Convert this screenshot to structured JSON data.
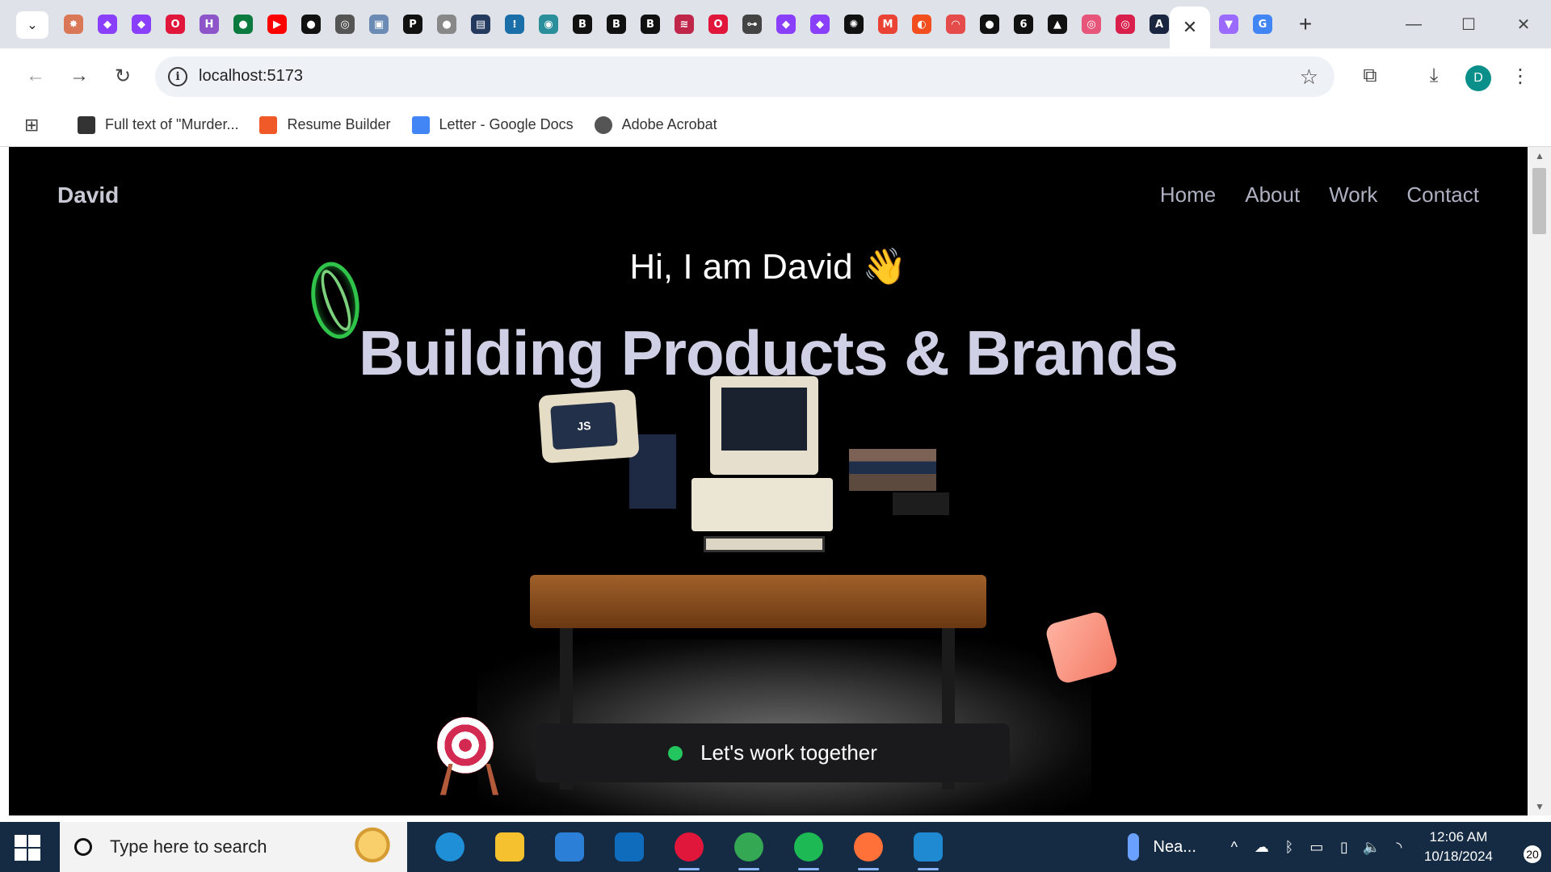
{
  "browser": {
    "tabstrip": {
      "search_tabs_icon": "chevron-down-icon",
      "pinned_tabs": [
        {
          "name": "claude-tab",
          "glyph": "✸",
          "color": "#d97757"
        },
        {
          "name": "hashnode-tab-1",
          "glyph": "◆",
          "color": "#8a3ffc"
        },
        {
          "name": "hashnode-tab-2",
          "glyph": "◆",
          "color": "#8a3ffc"
        },
        {
          "name": "opera-tab",
          "glyph": "O",
          "color": "#e0163a"
        },
        {
          "name": "h-tab",
          "glyph": "H",
          "color": "#8d55c9"
        },
        {
          "name": "mongodb-tab",
          "glyph": "●",
          "color": "#0b7a3e"
        },
        {
          "name": "youtube-tab",
          "glyph": "▶",
          "color": "#ff0000"
        },
        {
          "name": "github-tab-1",
          "glyph": "●",
          "color": "#111111"
        },
        {
          "name": "gitpod-tab",
          "glyph": "◎",
          "color": "#555555"
        },
        {
          "name": "image-tab",
          "glyph": "▣",
          "color": "#6b8bb5"
        },
        {
          "name": "p-tab",
          "glyph": "P",
          "color": "#111111"
        },
        {
          "name": "globe-tab",
          "glyph": "●",
          "color": "#888888"
        },
        {
          "name": "doc-tab",
          "glyph": "▤",
          "color": "#243a5e"
        },
        {
          "name": "cisco-tab",
          "glyph": "⁞",
          "color": "#1b6fa8"
        },
        {
          "name": "eye-tab",
          "glyph": "◉",
          "color": "#2a8f9a"
        },
        {
          "name": "bold-tab-1",
          "glyph": "B",
          "color": "#111111"
        },
        {
          "name": "bold-tab-2",
          "glyph": "B",
          "color": "#111111"
        },
        {
          "name": "bold-tab-3",
          "glyph": "B",
          "color": "#111111"
        },
        {
          "name": "flag-tab",
          "glyph": "≋",
          "color": "#c0254a"
        },
        {
          "name": "opera-tab-2",
          "glyph": "O",
          "color": "#e0163a"
        },
        {
          "name": "key-tab",
          "glyph": "⊶",
          "color": "#444444"
        },
        {
          "name": "hashnode-tab-3",
          "glyph": "◆",
          "color": "#8a3ffc"
        },
        {
          "name": "hashnode-tab-4",
          "glyph": "◆",
          "color": "#8a3ffc"
        },
        {
          "name": "openai-tab",
          "glyph": "✺",
          "color": "#111111"
        },
        {
          "name": "gmail-tab",
          "glyph": "M",
          "color": "#ea4335"
        },
        {
          "name": "figma-tab",
          "glyph": "◐",
          "color": "#f24e1e"
        },
        {
          "name": "rainbow-tab",
          "glyph": "◠",
          "color": "#e54b4b"
        },
        {
          "name": "github-tab-2",
          "glyph": "●",
          "color": "#111111"
        },
        {
          "name": "six-tab",
          "glyph": "6",
          "color": "#111111"
        },
        {
          "name": "triangle-tab",
          "glyph": "▲",
          "color": "#111111"
        },
        {
          "name": "target-tab-1",
          "glyph": "◎",
          "color": "#e8557a"
        },
        {
          "name": "target-tab-2",
          "glyph": "◎",
          "color": "#d91f4c"
        },
        {
          "name": "ai-tab",
          "glyph": "A",
          "color": "#1a2540"
        }
      ],
      "active_tab_close": "✕",
      "trailing_tabs": [
        {
          "name": "vite-tab",
          "glyph": "▼",
          "color": "#9b6bff"
        },
        {
          "name": "google-tab",
          "glyph": "G",
          "color": "#4285f4"
        }
      ],
      "new_tab": "+",
      "window_controls": [
        "—",
        "☐",
        "✕"
      ]
    },
    "toolbar": {
      "back": "←",
      "forward": "→",
      "reload": "↻",
      "url": "localhost:5173",
      "info_icon": "i",
      "star": "☆",
      "extensions": "⧉",
      "downloads": "⤓",
      "avatar_letter": "D",
      "menu": "⋮"
    },
    "bookmarks": [
      {
        "label": "Full text of \"Murder...",
        "color": "#333333"
      },
      {
        "label": "Resume Builder",
        "color": "#f05a28"
      },
      {
        "label": "Letter - Google Docs",
        "color": "#4285f4"
      },
      {
        "label": "Adobe Acrobat",
        "color": "#555555"
      }
    ]
  },
  "site": {
    "brand": "David",
    "nav": [
      "Home",
      "About",
      "Work",
      "Contact"
    ],
    "greeting": "Hi, I am David 👋",
    "headline": "Building Products & Brands",
    "tv_screen_text": "JS",
    "cta": "Let's work together",
    "colors": {
      "accent_green": "#22c55e",
      "headline": "#cfd0e6",
      "background": "#000000"
    }
  },
  "taskbar": {
    "search_placeholder": "Type here to search",
    "apps": [
      {
        "name": "edge",
        "color": "#1f8fd8",
        "open": false
      },
      {
        "name": "file-explorer",
        "color": "#f5c12e",
        "open": false
      },
      {
        "name": "microsoft-store",
        "color": "#2b7fd6",
        "open": false
      },
      {
        "name": "outlook",
        "color": "#0f6cbd",
        "open": false
      },
      {
        "name": "opera",
        "color": "#e0163a",
        "open": true
      },
      {
        "name": "chrome",
        "color": "#34a853",
        "open": true
      },
      {
        "name": "spotify",
        "color": "#1db954",
        "open": true
      },
      {
        "name": "firefox",
        "color": "#ff7139",
        "open": true
      },
      {
        "name": "vscode",
        "color": "#1f8ad2",
        "open": true
      }
    ],
    "weather": "Nea...",
    "tray_icons": [
      "^",
      "☁",
      "ᛒ",
      "▭",
      "▯",
      "🔈",
      "◝"
    ],
    "time": "12:06 AM",
    "date": "10/18/2024",
    "notifications": "20"
  }
}
